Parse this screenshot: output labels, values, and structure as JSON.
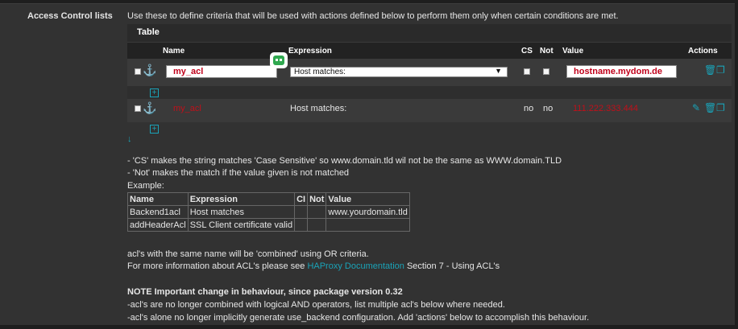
{
  "section": {
    "label": "Access Control lists",
    "description": "Use these to define criteria that will be used with actions defined below to perform them only when certain conditions are met."
  },
  "table": {
    "caption": "Table",
    "headers": {
      "name": "Name",
      "expression": "Expression",
      "cs": "CS",
      "not": "Not",
      "value": "Value",
      "actions": "Actions"
    },
    "edit_row": {
      "name": "my_acl",
      "expression": "Host matches:",
      "value": "hostname.mydom.de"
    },
    "rows": [
      {
        "name": "my_acl",
        "expression": "Host matches:",
        "cs": "no",
        "not": "no",
        "value": "111.222.333.444"
      }
    ]
  },
  "notes": {
    "line1": "- 'CS' makes the string matches 'Case Sensitive' so www.domain.tld wil not be the same as WWW.domain.TLD",
    "line2": "- 'Not' makes the match if the value given is not matched",
    "example_label": "Example:",
    "example_table": {
      "headers": [
        "Name",
        "Expression",
        "CI",
        "Not",
        "Value"
      ],
      "rows": [
        [
          "Backend1acl",
          "Host matches",
          "",
          "",
          "www.yourdomain.tld"
        ],
        [
          "addHeaderAcl",
          "SSL Client certificate valid",
          "",
          "",
          ""
        ]
      ]
    },
    "combined": "acl's with the same name will be 'combined' using OR criteria.",
    "more_info_prefix": "For more information about ACL's please see ",
    "more_info_link": "HAProxy Documentation",
    "more_info_suffix": " Section 7 - Using ACL's",
    "note_title": "NOTE Important change in behaviour, since package version 0.32",
    "note_line1": "-acl's are no longer combined with logical AND operators, list multiple acl's below where needed.",
    "note_line2": "-acl's alone no longer implicitly generate use_backend configuration. Add 'actions' below to accomplish this behaviour."
  },
  "colors": {
    "accent": "#1aa3b8",
    "value_red": "#c0101a",
    "panel": "#323232"
  },
  "icons": [
    "anchor-icon",
    "trash-icon",
    "copy-icon",
    "pencil-icon",
    "add-row-icon",
    "move-down-icon",
    "robot-icon",
    "chevron-down-icon"
  ]
}
